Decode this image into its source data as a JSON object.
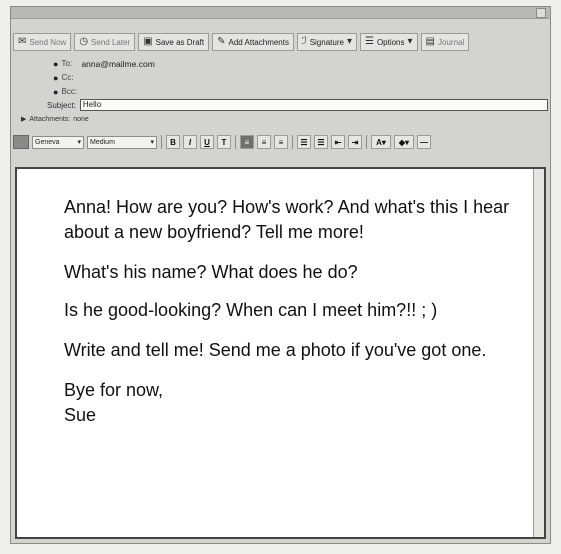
{
  "toolbar": {
    "send_now": "Send Now",
    "send_later": "Send Later",
    "save_draft": "Save as Draft",
    "add_attachments": "Add Attachments",
    "signature": "Signature",
    "options": "Options",
    "journal": "Journal"
  },
  "address": {
    "to_label": "To:",
    "to_value": "anna@mailme.com",
    "cc_label": "Cc:",
    "bcc_label": "Bcc:",
    "subject_label": "Subject:",
    "subject_value": "Hello",
    "attachments_label": "Attachments:",
    "attachments_value": "none"
  },
  "format": {
    "font": "Geneva",
    "size": "Medium",
    "bold": "B",
    "italic": "I",
    "underline": "U",
    "text_style": "T"
  },
  "message": {
    "paragraphs": [
      "Anna! How are you? How's work? And what's this I hear about a new boyfriend? Tell me more!",
      "What's his name? What does he do?",
      "Is he good-looking? When can I meet him?!! ; )",
      "Write and tell me! Send me a photo if you've got one.",
      "Bye for now,",
      "Sue"
    ]
  }
}
